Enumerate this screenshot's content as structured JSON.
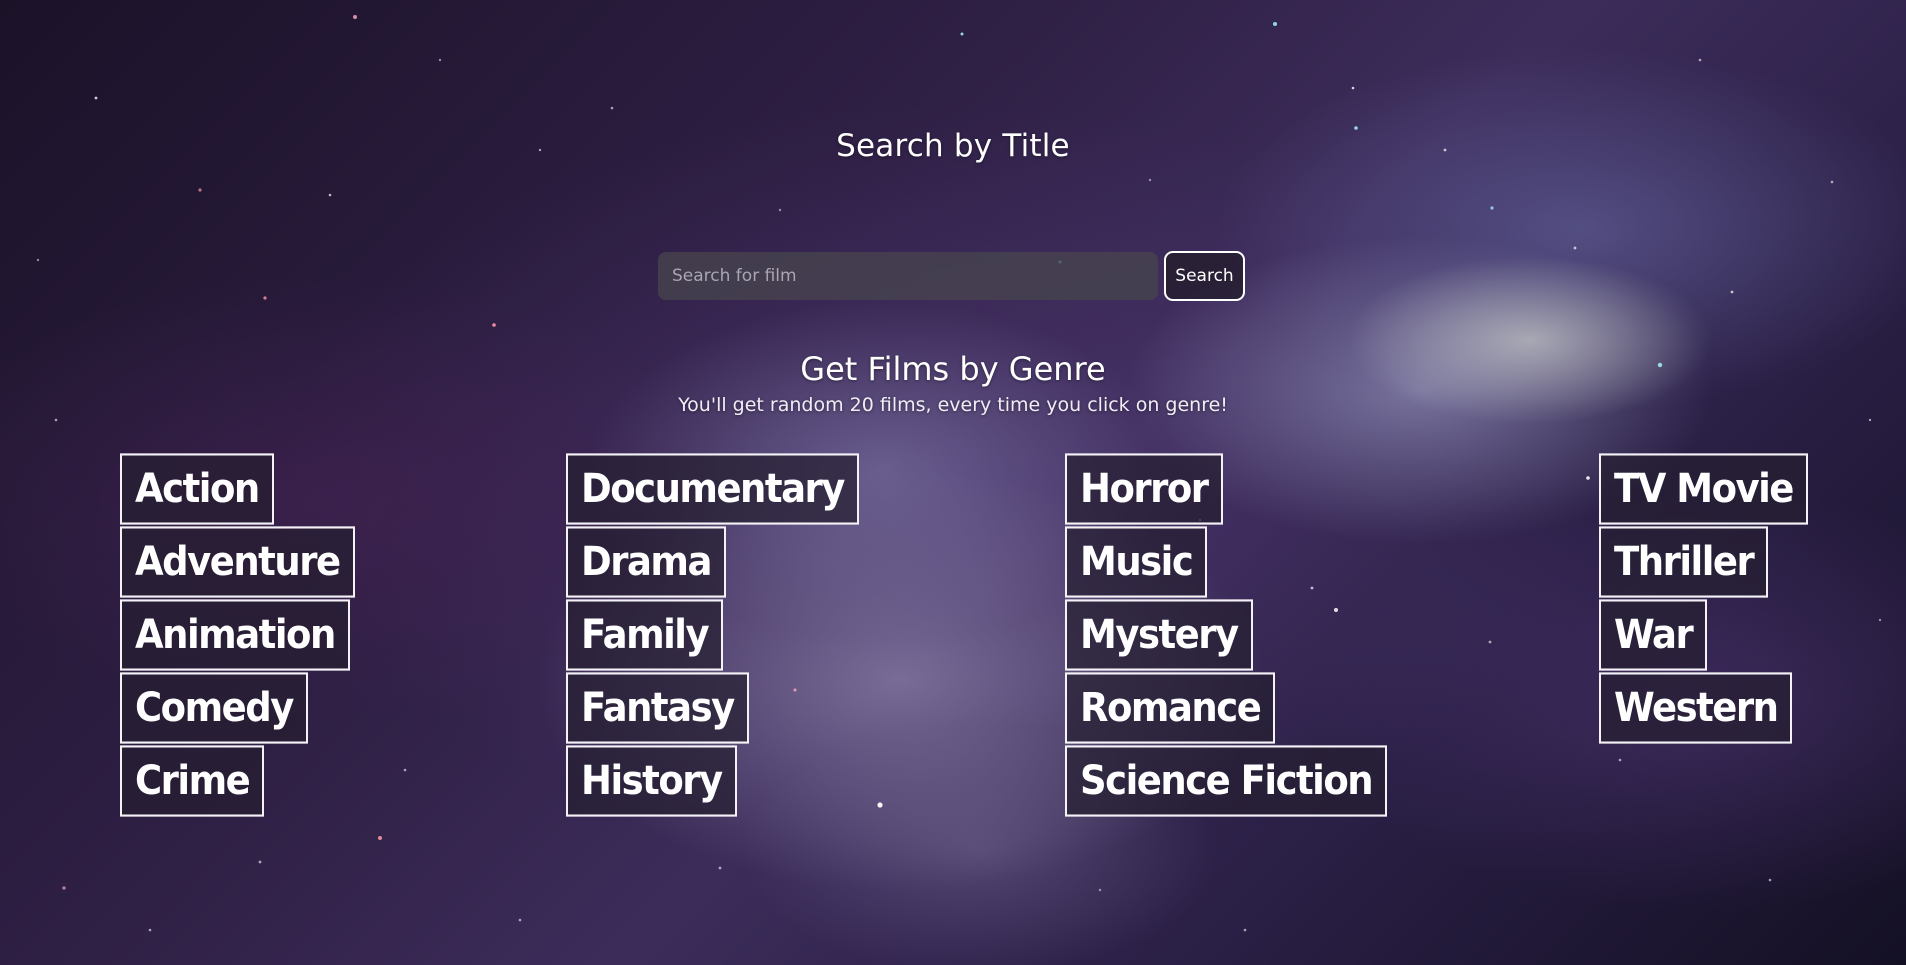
{
  "search_section": {
    "title": "Search by Title",
    "input_placeholder": "Search for film",
    "input_value": "",
    "button_label": "Search"
  },
  "genre_section": {
    "title": "Get Films by Genre",
    "subtitle": "You'll get random 20 films, every time you click on genre!",
    "columns": [
      [
        "Action",
        "Adventure",
        "Animation",
        "Comedy",
        "Crime"
      ],
      [
        "Documentary",
        "Drama",
        "Family",
        "Fantasy",
        "History"
      ],
      [
        "Horror",
        "Music",
        "Mystery",
        "Romance",
        "Science Fiction"
      ],
      [
        "TV Movie",
        "Thriller",
        "War",
        "Western"
      ]
    ]
  },
  "colors": {
    "text": "#ffffff",
    "button_border": "#f4f2f7",
    "input_background": "#46444e",
    "background_deep": "#1b1228",
    "nebula": "#aaafd7"
  }
}
